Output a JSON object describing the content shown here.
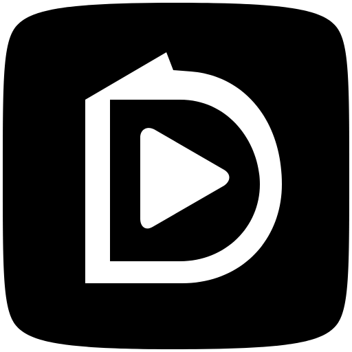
{
  "icon": {
    "semantic": "replay-video-app-icon",
    "background_color": "#000000",
    "glyph_color": "#ffffff",
    "page_color": "#ffffff"
  }
}
